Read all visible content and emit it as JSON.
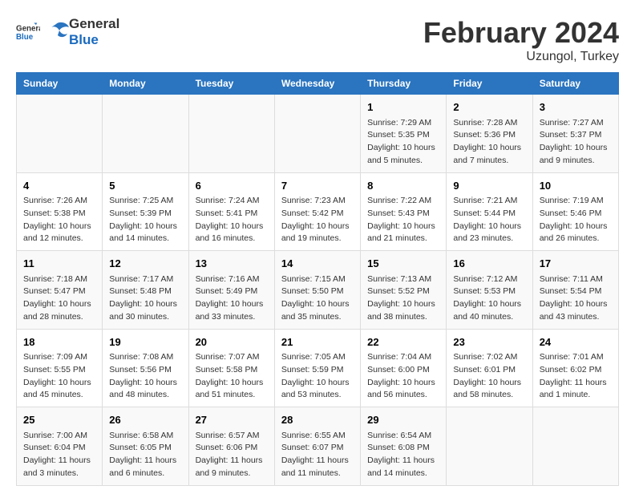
{
  "logo": {
    "general": "General",
    "blue": "Blue"
  },
  "title": "February 2024",
  "subtitle": "Uzungol, Turkey",
  "days_header": [
    "Sunday",
    "Monday",
    "Tuesday",
    "Wednesday",
    "Thursday",
    "Friday",
    "Saturday"
  ],
  "weeks": [
    [
      {
        "day": "",
        "info": ""
      },
      {
        "day": "",
        "info": ""
      },
      {
        "day": "",
        "info": ""
      },
      {
        "day": "",
        "info": ""
      },
      {
        "day": "1",
        "info": "Sunrise: 7:29 AM\nSunset: 5:35 PM\nDaylight: 10 hours\nand 5 minutes."
      },
      {
        "day": "2",
        "info": "Sunrise: 7:28 AM\nSunset: 5:36 PM\nDaylight: 10 hours\nand 7 minutes."
      },
      {
        "day": "3",
        "info": "Sunrise: 7:27 AM\nSunset: 5:37 PM\nDaylight: 10 hours\nand 9 minutes."
      }
    ],
    [
      {
        "day": "4",
        "info": "Sunrise: 7:26 AM\nSunset: 5:38 PM\nDaylight: 10 hours\nand 12 minutes."
      },
      {
        "day": "5",
        "info": "Sunrise: 7:25 AM\nSunset: 5:39 PM\nDaylight: 10 hours\nand 14 minutes."
      },
      {
        "day": "6",
        "info": "Sunrise: 7:24 AM\nSunset: 5:41 PM\nDaylight: 10 hours\nand 16 minutes."
      },
      {
        "day": "7",
        "info": "Sunrise: 7:23 AM\nSunset: 5:42 PM\nDaylight: 10 hours\nand 19 minutes."
      },
      {
        "day": "8",
        "info": "Sunrise: 7:22 AM\nSunset: 5:43 PM\nDaylight: 10 hours\nand 21 minutes."
      },
      {
        "day": "9",
        "info": "Sunrise: 7:21 AM\nSunset: 5:44 PM\nDaylight: 10 hours\nand 23 minutes."
      },
      {
        "day": "10",
        "info": "Sunrise: 7:19 AM\nSunset: 5:46 PM\nDaylight: 10 hours\nand 26 minutes."
      }
    ],
    [
      {
        "day": "11",
        "info": "Sunrise: 7:18 AM\nSunset: 5:47 PM\nDaylight: 10 hours\nand 28 minutes."
      },
      {
        "day": "12",
        "info": "Sunrise: 7:17 AM\nSunset: 5:48 PM\nDaylight: 10 hours\nand 30 minutes."
      },
      {
        "day": "13",
        "info": "Sunrise: 7:16 AM\nSunset: 5:49 PM\nDaylight: 10 hours\nand 33 minutes."
      },
      {
        "day": "14",
        "info": "Sunrise: 7:15 AM\nSunset: 5:50 PM\nDaylight: 10 hours\nand 35 minutes."
      },
      {
        "day": "15",
        "info": "Sunrise: 7:13 AM\nSunset: 5:52 PM\nDaylight: 10 hours\nand 38 minutes."
      },
      {
        "day": "16",
        "info": "Sunrise: 7:12 AM\nSunset: 5:53 PM\nDaylight: 10 hours\nand 40 minutes."
      },
      {
        "day": "17",
        "info": "Sunrise: 7:11 AM\nSunset: 5:54 PM\nDaylight: 10 hours\nand 43 minutes."
      }
    ],
    [
      {
        "day": "18",
        "info": "Sunrise: 7:09 AM\nSunset: 5:55 PM\nDaylight: 10 hours\nand 45 minutes."
      },
      {
        "day": "19",
        "info": "Sunrise: 7:08 AM\nSunset: 5:56 PM\nDaylight: 10 hours\nand 48 minutes."
      },
      {
        "day": "20",
        "info": "Sunrise: 7:07 AM\nSunset: 5:58 PM\nDaylight: 10 hours\nand 51 minutes."
      },
      {
        "day": "21",
        "info": "Sunrise: 7:05 AM\nSunset: 5:59 PM\nDaylight: 10 hours\nand 53 minutes."
      },
      {
        "day": "22",
        "info": "Sunrise: 7:04 AM\nSunset: 6:00 PM\nDaylight: 10 hours\nand 56 minutes."
      },
      {
        "day": "23",
        "info": "Sunrise: 7:02 AM\nSunset: 6:01 PM\nDaylight: 10 hours\nand 58 minutes."
      },
      {
        "day": "24",
        "info": "Sunrise: 7:01 AM\nSunset: 6:02 PM\nDaylight: 11 hours\nand 1 minute."
      }
    ],
    [
      {
        "day": "25",
        "info": "Sunrise: 7:00 AM\nSunset: 6:04 PM\nDaylight: 11 hours\nand 3 minutes."
      },
      {
        "day": "26",
        "info": "Sunrise: 6:58 AM\nSunset: 6:05 PM\nDaylight: 11 hours\nand 6 minutes."
      },
      {
        "day": "27",
        "info": "Sunrise: 6:57 AM\nSunset: 6:06 PM\nDaylight: 11 hours\nand 9 minutes."
      },
      {
        "day": "28",
        "info": "Sunrise: 6:55 AM\nSunset: 6:07 PM\nDaylight: 11 hours\nand 11 minutes."
      },
      {
        "day": "29",
        "info": "Sunrise: 6:54 AM\nSunset: 6:08 PM\nDaylight: 11 hours\nand 14 minutes."
      },
      {
        "day": "",
        "info": ""
      },
      {
        "day": "",
        "info": ""
      }
    ]
  ]
}
